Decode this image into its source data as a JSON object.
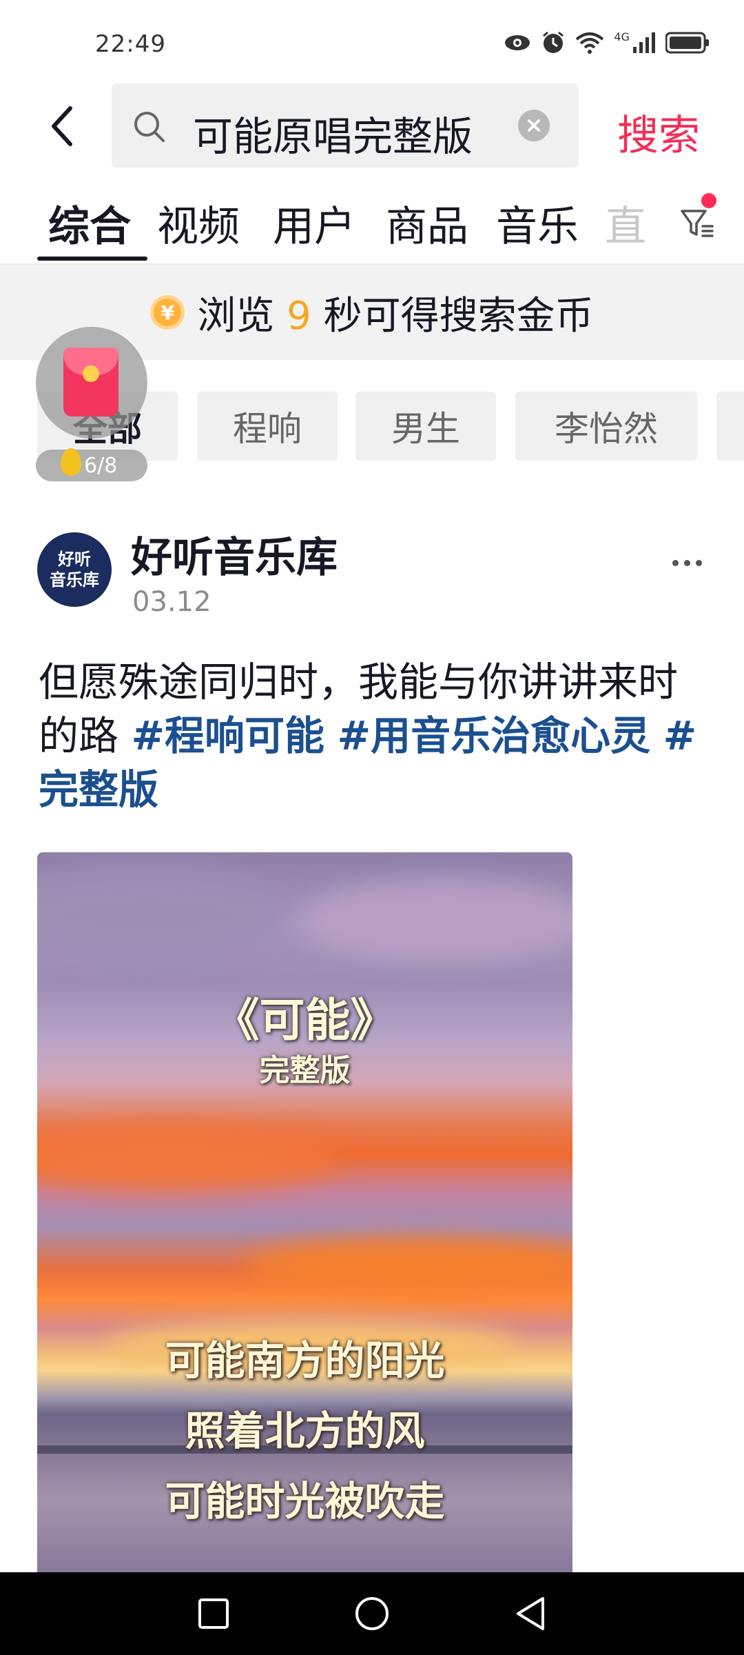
{
  "status_bar": {
    "time": "22:49",
    "network": "4G",
    "icons": [
      "eye-icon",
      "alarm-icon",
      "wifi-icon",
      "signal-icon",
      "battery-icon"
    ]
  },
  "search": {
    "query": "可能原唱完整版",
    "submit_label": "搜索",
    "back_icon": "back-arrow-icon",
    "clear_icon": "clear-icon"
  },
  "tabs": {
    "items": [
      "综合",
      "视频",
      "用户",
      "商品",
      "音乐"
    ],
    "partial": "直",
    "active_index": 0,
    "filter_icon": "filter-icon"
  },
  "coin_banner": {
    "coin_symbol": "¥",
    "prefix": "浏览",
    "seconds": "9",
    "suffix": "秒可得搜索金币"
  },
  "chips": {
    "items": [
      "全部",
      "程响",
      "男生",
      "李怡然"
    ]
  },
  "red_envelope": {
    "progress": "6/8"
  },
  "post": {
    "avatar_line1": "好听",
    "avatar_line2": "音乐库",
    "author": "好听音乐库",
    "date": "03.12",
    "text": "但愿殊途同归时，我能与你讲讲来时的路",
    "hashtags": [
      "#程响可能",
      "#用音乐治愈心灵",
      "#完整版"
    ]
  },
  "video": {
    "title": "《可能》",
    "subtitle": "完整版",
    "lyrics": [
      "可能南方的阳光",
      "照着北方的风",
      "可能时光被吹走"
    ]
  },
  "colors": {
    "accent": "#fe2c55",
    "hashtag": "#1b4f8f",
    "coin": "#f5a623"
  }
}
